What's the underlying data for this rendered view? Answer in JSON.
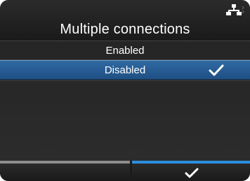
{
  "header": {
    "title": "Multiple connections",
    "status_icon": "network-icon"
  },
  "options": [
    {
      "label": "Enabled",
      "selected": false
    },
    {
      "label": "Disabled",
      "selected": true
    }
  ],
  "selection_mark": "check-icon",
  "footer": {
    "left_softkey_label": "",
    "right_softkey_icon": "check-icon"
  },
  "colors": {
    "background": "#242424",
    "selected_row": "#2668a0",
    "left_softkey_bar": "#8e8e8e",
    "right_softkey_bar": "#2c8fdf",
    "text": "#ffffff"
  }
}
